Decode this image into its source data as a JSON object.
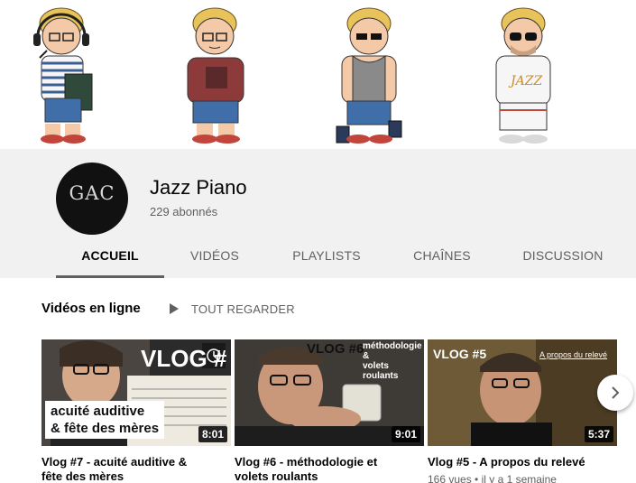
{
  "channel": {
    "avatar_text": "GAC",
    "name": "Jazz Piano",
    "subscribers": "229 abonnés"
  },
  "tabs": [
    {
      "label": "ACCUEIL",
      "active": true
    },
    {
      "label": "VIDÉOS",
      "active": false
    },
    {
      "label": "PLAYLISTS",
      "active": false
    },
    {
      "label": "CHAÎNES",
      "active": false
    },
    {
      "label": "DISCUSSION",
      "active": false
    }
  ],
  "shelf": {
    "title": "Vidéos en ligne",
    "play_all_label": "TOUT REGARDER",
    "play_all_icon": "play-icon",
    "next_icon": "chevron-right-icon"
  },
  "videos": [
    {
      "title_line1": "Vlog #7 - acuité auditive &",
      "title_line2": "fête des mères",
      "duration": "8:01",
      "meta": "",
      "overlay_title": "VLOG #",
      "caption_line1": "acuité auditive",
      "caption_line2": "& fête des mères",
      "watch_later_icon": "clock-icon"
    },
    {
      "title_line1": "Vlog #6 - méthodologie et",
      "title_line2": "volets roulants",
      "duration": "9:01",
      "meta": "",
      "overlay_title": "VLOG #6",
      "caption_line1": "méthodologie",
      "caption_line2": "&",
      "caption_line3": "volets roulants"
    },
    {
      "title_line1": "Vlog #5 - A propos du relevé",
      "title_line2": "",
      "duration": "5:37",
      "meta": "166 vues • il y a 1 semaine",
      "overlay_title": "VLOG #5",
      "overlay_subtitle": "A propos du relevé"
    }
  ],
  "colors": {
    "header_bg": "#f1f1f1",
    "text_primary": "#030303",
    "text_secondary": "#606060"
  }
}
